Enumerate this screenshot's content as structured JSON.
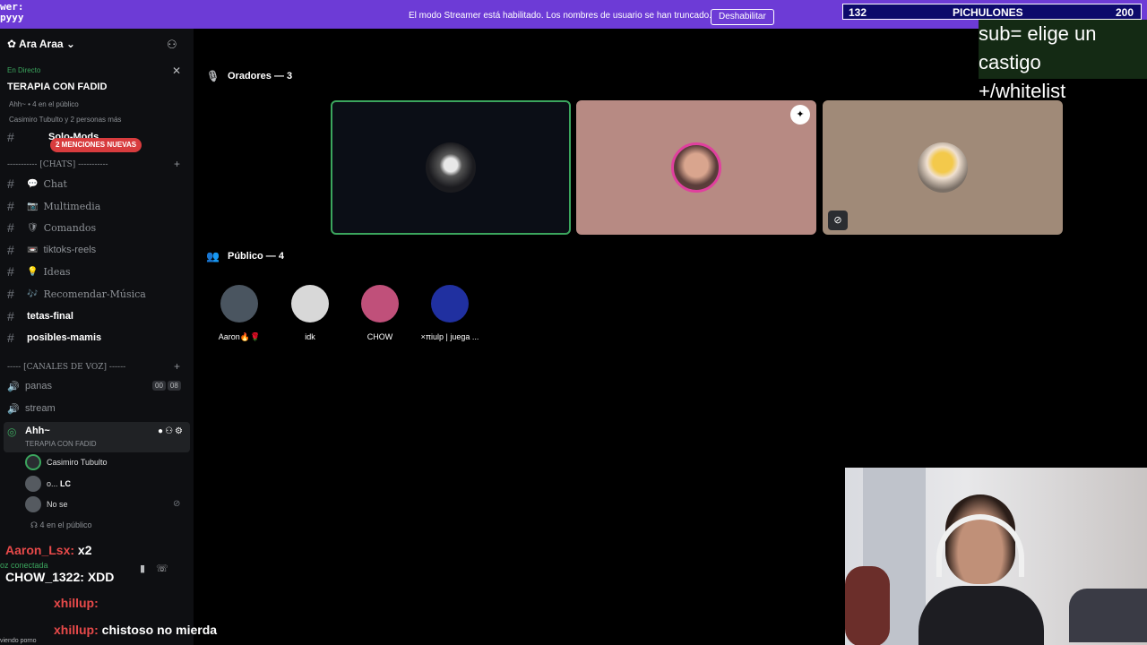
{
  "banner": {
    "logo": "wer:\npyyy",
    "message": "El modo Streamer está habilitado. Los nombres de usuario se han truncado.",
    "button": "Deshabilitar"
  },
  "counter": {
    "current": "132",
    "label": "PICHULONES",
    "goal": "200"
  },
  "overlay": {
    "line1": "sub= elige un castigo",
    "line2": "+/whitelist"
  },
  "sidebar": {
    "server_name": "Ara Araa",
    "live": {
      "status": "En Directo",
      "title": "TERAPIA CON FADID",
      "sub": "Ahh~ • 4 en el público",
      "sub2": "Casimiro Tubulto y 2 personas más"
    },
    "mention_badge": "2 MENCIONES NUEVAS",
    "solo_mods": "Solo-Mods",
    "chats_category": "----------- [CHATS] -----------",
    "text_channels": [
      {
        "emoji": "💬",
        "label": "Chat"
      },
      {
        "emoji": "📷",
        "label": "Multimedia"
      },
      {
        "emoji": "🛡",
        "label": "Comandos"
      },
      {
        "emoji": "📼",
        "label": "tiktoks-reels"
      },
      {
        "emoji": "💡",
        "label": "Ideas"
      },
      {
        "emoji": "🎶",
        "label": "Recomendar-Música"
      },
      {
        "emoji": "",
        "label": "tetas-final"
      },
      {
        "emoji": "",
        "label": "posibles-mamis"
      }
    ],
    "voice_category": "----- [CANALES DE VOZ] ------",
    "voice_channels": [
      {
        "label": "panas",
        "counts": [
          "00",
          "08"
        ]
      },
      {
        "label": "stream"
      }
    ],
    "active_voice": {
      "name": "Ahh~",
      "subtitle": "TERAPIA CON FADID",
      "members": [
        {
          "name": "Casimiro Tubulto"
        },
        {
          "name": "o...",
          "tag": "LC"
        },
        {
          "name": "No se"
        }
      ],
      "audience": "4 en el público"
    },
    "voice_connected": "oz conectada",
    "viewing": "viendo porno"
  },
  "chat_overlay": [
    {
      "user": "Aaron_Lsx:",
      "text": "x2"
    },
    {
      "user": "CHOW_1322:",
      "text": "XDD"
    },
    {
      "user": "xhillup:",
      "text": ""
    },
    {
      "user": "xhillup:",
      "text": "chistoso no mierda"
    }
  ],
  "stage": {
    "speakers_header": "Oradores — 3",
    "audience_header": "Público — 4",
    "audience": [
      {
        "name": "Aaron🔥🌹",
        "color": "#4a5560"
      },
      {
        "name": "idk",
        "color": "#d8d8d8"
      },
      {
        "name": "CHOW",
        "color": "#c0507a"
      },
      {
        "name": "×πiulp | juega ...",
        "color": "#2030a0"
      }
    ]
  }
}
